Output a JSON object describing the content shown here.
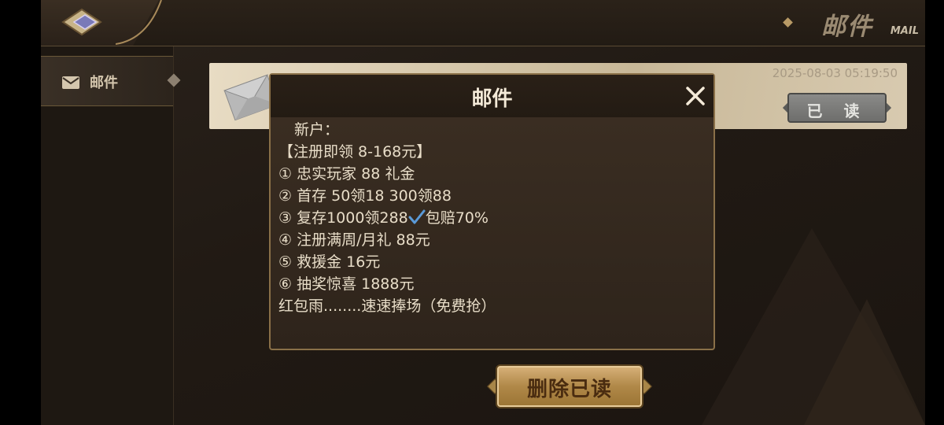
{
  "header": {
    "title": "邮件",
    "subtitle": "MAIL"
  },
  "sidebar": {
    "items": [
      {
        "label": "邮件",
        "icon": "envelope-icon",
        "selected": true
      }
    ]
  },
  "mail_list": {
    "items": [
      {
        "timestamp": "2025-08-03 05:19:50",
        "status_label": "已 读",
        "icon": "envelope-icon"
      }
    ]
  },
  "dialog": {
    "title": "邮件",
    "close_icon": "close-icon",
    "lines": [
      "  新户：",
      "【注册即领 8-168元】",
      "① 忠实玩家  88  礼金",
      "② 首存 50领18  300领88",
      "③ 复存1000领288",
      "④ 注册满周/月礼 88元",
      "⑤ 救援金 16元",
      "⑥ 抽奖惊喜 1888元",
      "红包雨........速速捧场（免费抢）"
    ],
    "line3_suffix": "包赔70%"
  },
  "actions": {
    "delete_read_label": "删除已读"
  },
  "colors": {
    "accent_gold": "#b08848",
    "dialog_border": "#8a7048",
    "text_light": "#e8ddc8"
  }
}
